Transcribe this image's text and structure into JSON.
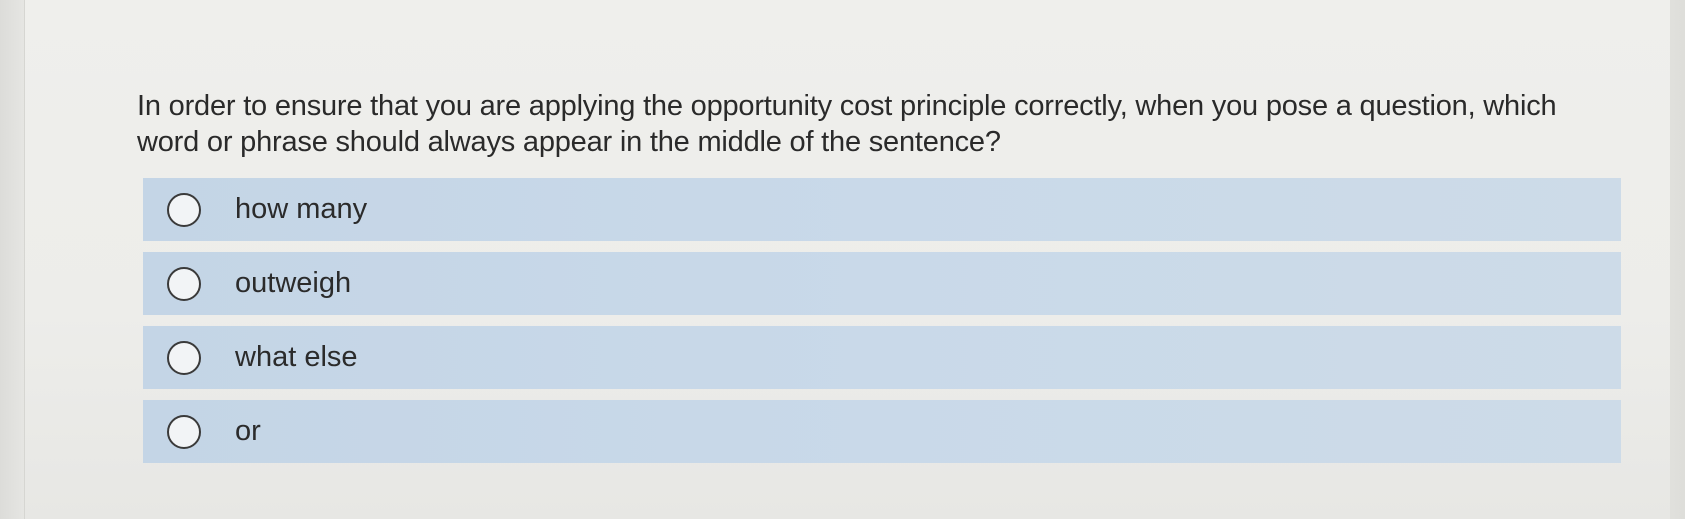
{
  "question": {
    "text": "In order to ensure that you are applying the opportunity cost principle correctly, when you pose a question, which word or phrase should always appear in the middle of the sentence?"
  },
  "options": [
    {
      "label": "how many",
      "selected": false
    },
    {
      "label": "outweigh",
      "selected": false
    },
    {
      "label": "what else",
      "selected": false
    },
    {
      "label": "or",
      "selected": false
    }
  ],
  "colors": {
    "option_background": "#c8d8e8",
    "text": "#2a2a2a",
    "page_background": "#eeeeec"
  }
}
